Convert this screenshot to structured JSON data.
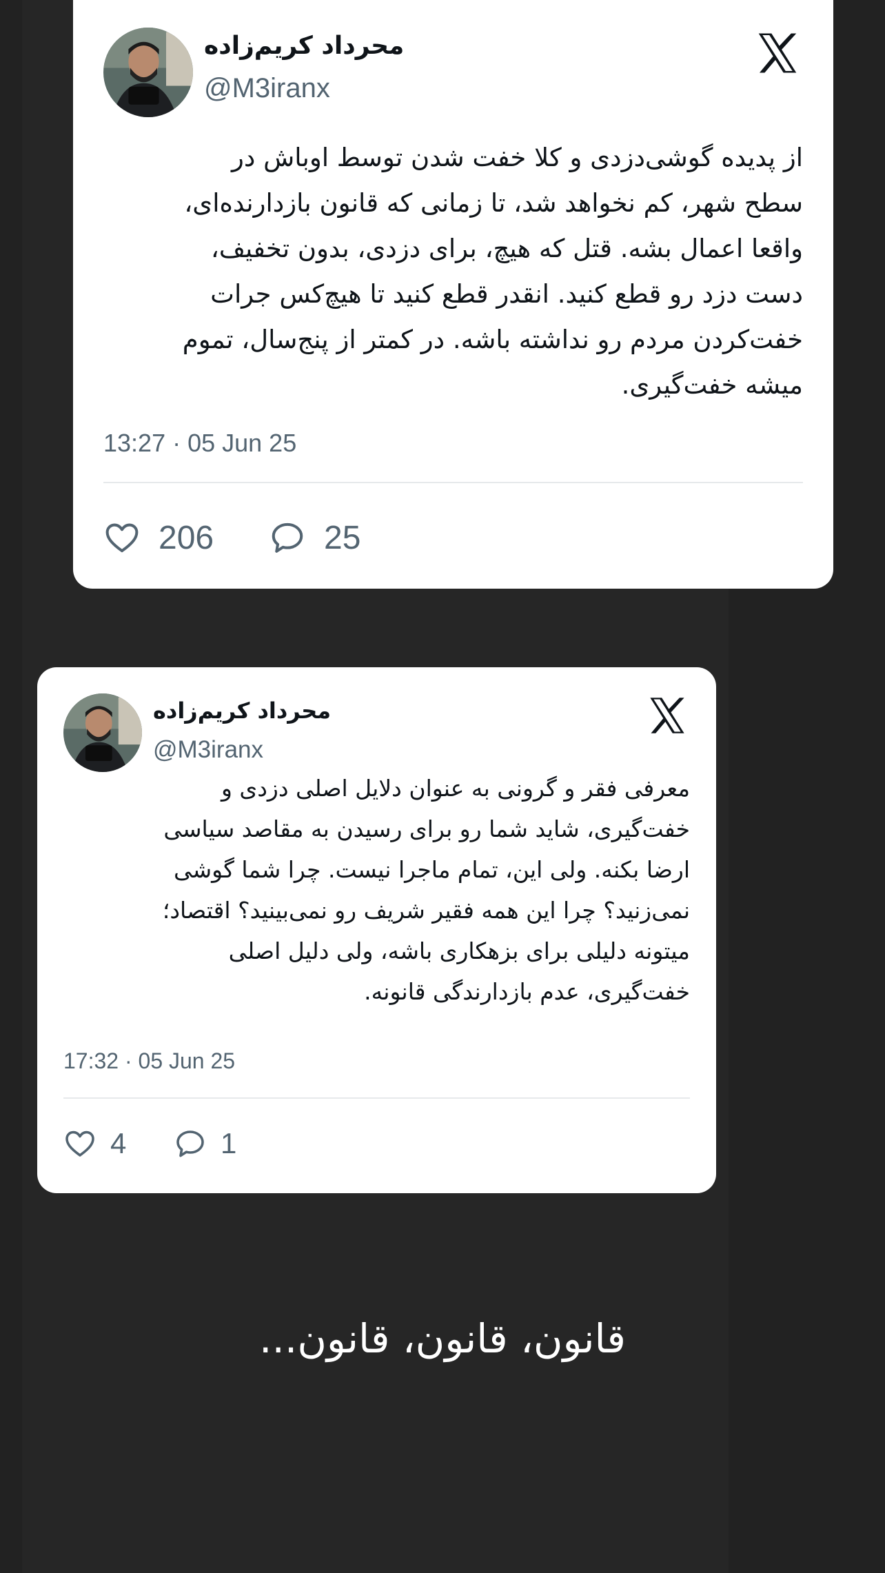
{
  "tweets": [
    {
      "author_name": "محرداد کریم‌زاده",
      "handle": "@M3iranx",
      "text_lines": [
        "از پدیده گوشی‌دزدی و کلا خفت شدن توسط اوباش در",
        "سطح شهر، کم نخواهد شد، تا زمانی که قانون بازدارنده‌ای،",
        "واقعا اعمال بشه. قتل که هیچ، برای دزدی، بدون تخفیف،",
        "دست دزد رو قطع کنید. انقدر قطع کنید تا هیچ‌کس جرات",
        "خفت‌کردن مردم رو نداشته باشه. در کمتر از پنج‌سال، تموم",
        "میشه خفت‌گیری."
      ],
      "timestamp": "13:27 · 05 Jun 25",
      "likes": "206",
      "replies": "25",
      "icons": {
        "platform": "x-logo-icon",
        "like": "heart-icon",
        "reply": "speech-bubble-icon"
      }
    },
    {
      "author_name": "محرداد کریم‌زاده",
      "handle": "@M3iranx",
      "text_lines": [
        "معرفی فقر و گرونی به عنوان دلایل اصلی دزدی و",
        "خفت‌گیری، شاید شما رو برای رسیدن به مقاصد سیاسی",
        "ارضا بکنه. ولی این، تمام ماجرا نیست. چرا شما گوشی",
        "نمی‌زنید؟ چرا این همه فقیر شریف رو نمی‌بینید؟ اقتصاد؛",
        "میتونه دلیلی برای بزهکاری باشه، ولی دلیل اصلی",
        "خفت‌گیری، عدم بازدارندگی قانونه."
      ],
      "timestamp": "17:32 · 05 Jun 25",
      "likes": "4",
      "replies": "1",
      "icons": {
        "platform": "x-logo-icon",
        "like": "heart-icon",
        "reply": "speech-bubble-icon"
      }
    }
  ],
  "caption": "قانون، قانون، قانون...",
  "colors": {
    "background": "#222222",
    "card": "#ffffff",
    "text": "#0f1419",
    "secondary_text": "#536471",
    "caption_text": "#ffffff"
  }
}
